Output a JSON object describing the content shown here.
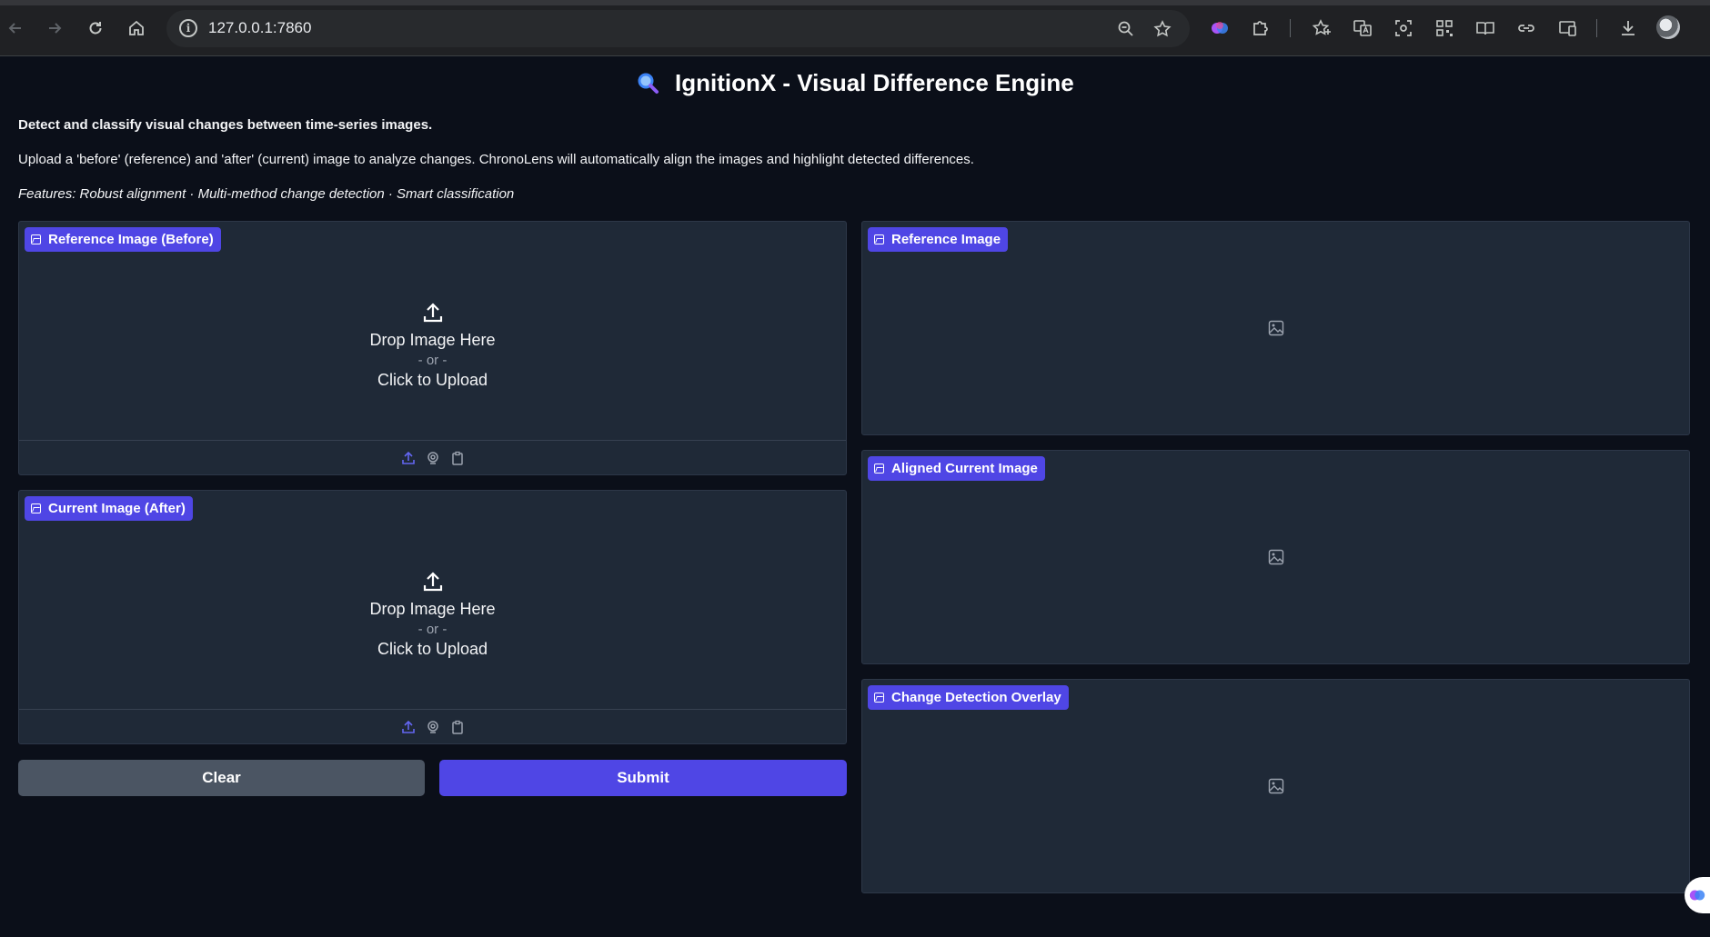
{
  "browser": {
    "url": "127.0.0.1:7860",
    "icons": [
      "back-icon",
      "forward-icon",
      "reload-icon",
      "home-icon",
      "site-info-icon",
      "zoom-icon",
      "bookmark-star-icon",
      "extension-icon",
      "puzzle-icon",
      "favorites-icon",
      "translate-icon",
      "screenshot-icon",
      "qr-code-icon",
      "reading-mode-icon",
      "link-icon",
      "cast-icon",
      "download-icon",
      "profile-avatar"
    ]
  },
  "app": {
    "title": "IgnitionX - Visual Difference Engine",
    "desc_bold": "Detect and classify visual changes between time-series images.",
    "desc_main": "Upload a 'before' (reference) and 'after' (current) image to analyze changes. ChronoLens will automatically align the images and highlight detected differences.",
    "desc_features": "Features: Robust alignment · Multi-method change detection · Smart classification"
  },
  "inputs": {
    "reference": {
      "label": "Reference Image (Before)",
      "drop": "Drop Image Here",
      "or": "- or -",
      "click": "Click to Upload"
    },
    "current": {
      "label": "Current Image (After)",
      "drop": "Drop Image Here",
      "or": "- or -",
      "click": "Click to Upload"
    }
  },
  "buttons": {
    "clear": "Clear",
    "submit": "Submit"
  },
  "outputs": {
    "reference": "Reference Image",
    "aligned": "Aligned Current Image",
    "overlay": "Change Detection Overlay"
  },
  "colors": {
    "accent": "#4f46e5",
    "panel": "#1f2937",
    "background": "#0b0f19",
    "secondary_button": "#4b5563"
  }
}
